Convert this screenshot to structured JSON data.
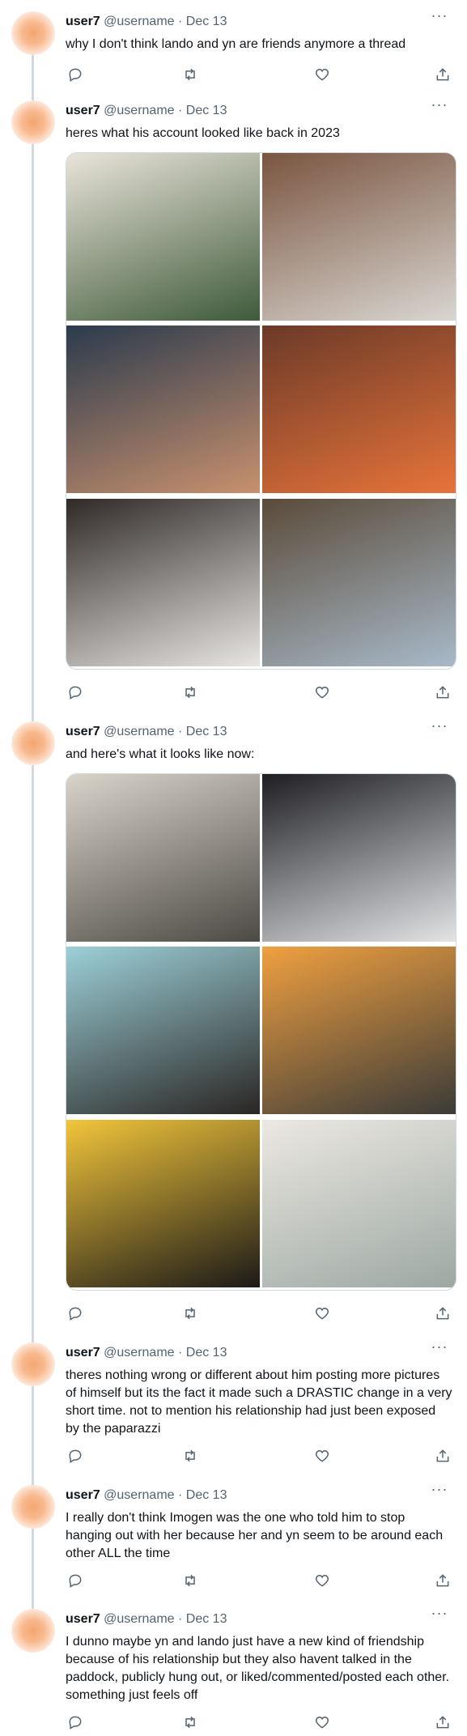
{
  "tweets": [
    {
      "name": "user7",
      "handle": "@username",
      "date": "Dec 13",
      "text": "why I don't think lando and yn are friends anymore a thread"
    },
    {
      "name": "user7",
      "handle": "@username",
      "date": "Dec 13",
      "text": "heres what his account looked like back in 2023",
      "photos": [
        {
          "desc": "photo-1",
          "c1": "#3f5a3a",
          "c2": "#e9e4da"
        },
        {
          "desc": "photo-2",
          "c1": "#d9d6d1",
          "c2": "#7a5540"
        },
        {
          "desc": "photo-3",
          "c1": "#c8906e",
          "c2": "#2b3b4d"
        },
        {
          "desc": "photo-4",
          "c1": "#e7733a",
          "c2": "#6b3a28"
        },
        {
          "desc": "photo-5",
          "c1": "#e8e6e3",
          "c2": "#2f2a28"
        },
        {
          "desc": "photo-6",
          "c1": "#a8b9c8",
          "c2": "#5a4b3a"
        }
      ]
    },
    {
      "name": "user7",
      "handle": "@username",
      "date": "Dec 13",
      "text": "and here's what it looks like now:",
      "photos": [
        {
          "desc": "photo-1",
          "c1": "#4c4a44",
          "c2": "#d9d4ca"
        },
        {
          "desc": "photo-2",
          "c1": "#e2e4e6",
          "c2": "#1e1e22"
        },
        {
          "desc": "photo-3",
          "c1": "#2a2624",
          "c2": "#9cd0d8"
        },
        {
          "desc": "photo-4",
          "c1": "#3b3b38",
          "c2": "#f0a040"
        },
        {
          "desc": "photo-5",
          "c1": "#1b1a18",
          "c2": "#f2c53a"
        },
        {
          "desc": "photo-6",
          "c1": "#9da8a3",
          "c2": "#ece8e2"
        }
      ]
    },
    {
      "name": "user7",
      "handle": "@username",
      "date": "Dec 13",
      "text": "theres nothing wrong or different about him posting more pictures of himself but its the fact it made such a DRASTIC change in a very short time. not to mention his relationship had just been exposed by the paparazzi"
    },
    {
      "name": "user7",
      "handle": "@username",
      "date": "Dec 13",
      "text": "I really don't think Imogen was the one who told him to stop hanging out with her because her and yn seem to be around each other ALL the time"
    },
    {
      "name": "user7",
      "handle": "@username",
      "date": "Dec 13",
      "text": "I dunno maybe yn and lando just have a new kind of friendship because of his relationship but they also havent talked in the paddock, publicly hung out, or liked/commented/posted each other. something just feels off"
    }
  ],
  "meta": {
    "separator": " · ",
    "more_glyph": "···"
  },
  "colors": {
    "text": "#0f1419",
    "secondary": "#536471",
    "thread_line": "#cfd9de",
    "avatar": "#f4a672"
  },
  "icons": [
    "reply-icon",
    "retweet-icon",
    "like-icon",
    "share-icon",
    "more-icon"
  ]
}
